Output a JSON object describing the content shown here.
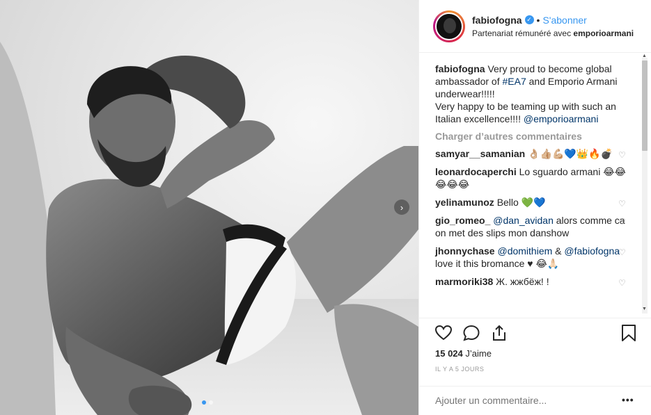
{
  "post": {
    "username": "fabiofogna",
    "follow_label": "S'abonner",
    "separator": "•",
    "partner_prefix": "Partenariat rémunéré avec",
    "partner_name": "emporioarmani",
    "verified_icon": "checkmark"
  },
  "caption": {
    "username": "fabiofogna",
    "text_a": "Very proud to become global ambassador of",
    "hashtag": "#EA7",
    "text_b": "and Emporio Armani underwear!!!!!",
    "text_c": "Very happy to be teaming up with such an Italian excellence!!!!",
    "mention": "@emporioarmani"
  },
  "load_more_label": "Charger d’autres commentaires",
  "comments": [
    {
      "username": "samyar__samanian",
      "text": "👌🏼👍🏼💪🏼💙👑🔥💣"
    },
    {
      "username": "leonardocaperchi",
      "text": "Lo sguardo armani 😂😂😂😂😂"
    },
    {
      "username": "yelinamunoz",
      "text": "Bello 💚💙"
    },
    {
      "username": "gio_romeo_",
      "mention": "@dan_avidan",
      "text": "alors comme ca on met des slips mon danshow"
    },
    {
      "username": "jhonnychase",
      "mention": "@domithiem",
      "text_mid": "&",
      "mention2": "@fabiofogna",
      "text": "love it this bromance ♥ 😂🙏🏻"
    },
    {
      "username": "marmoriki38",
      "text": "Ж. жжбёж! !"
    }
  ],
  "likes": {
    "count": "15 024",
    "label": "J’aime"
  },
  "timestamp": "IL Y A 5 JOURS",
  "add_comment_placeholder": "Ajouter un commentaire...",
  "more_label": "•••",
  "icons": {
    "next": "chevron-right",
    "like": "heart-outline",
    "comment": "speech-bubble",
    "share": "share-upload",
    "save": "bookmark"
  },
  "colors": {
    "accent": "#3897f0",
    "muted": "#999999",
    "text": "#262626"
  }
}
